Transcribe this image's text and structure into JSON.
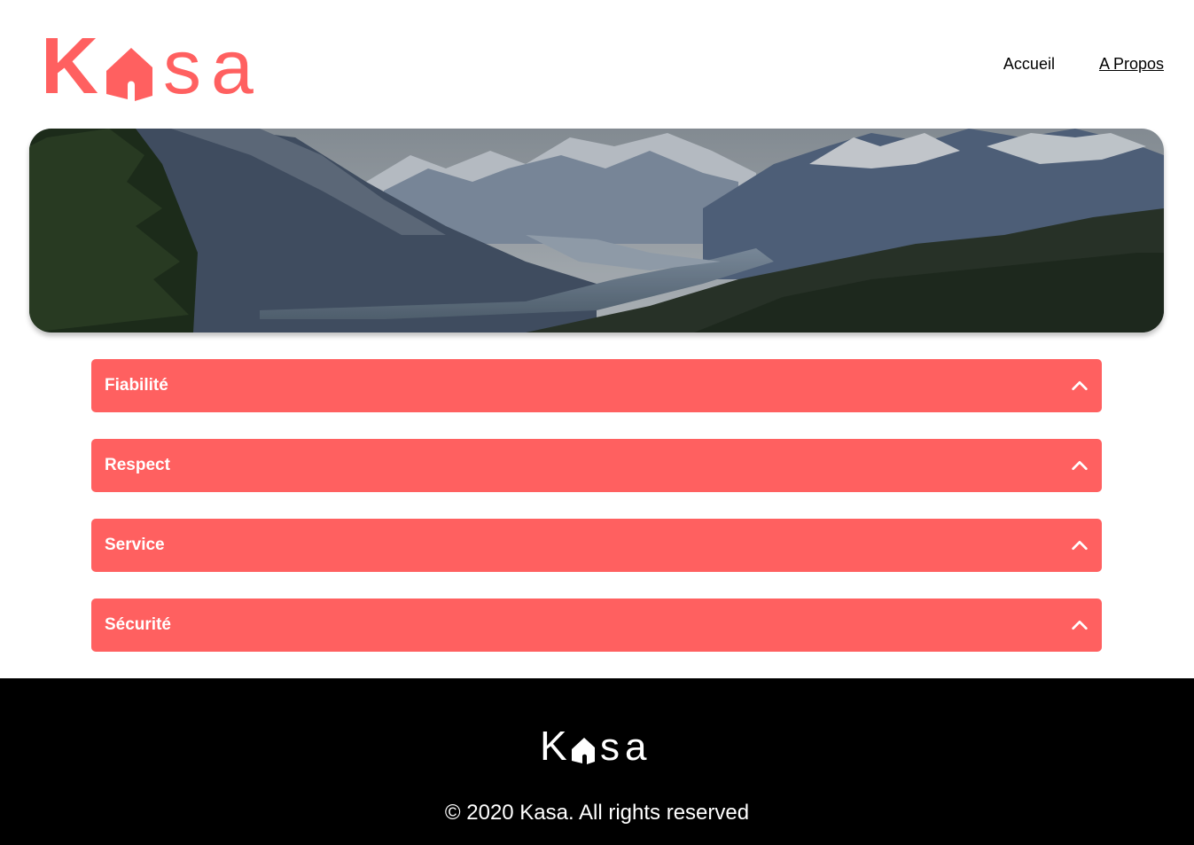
{
  "brand": {
    "name": "Kasa",
    "logo_letters": [
      "K",
      "s",
      "a"
    ],
    "accent_color": "#ff6060",
    "logo_icon": "house-icon"
  },
  "nav": {
    "items": [
      {
        "label": "Accueil",
        "active": false
      },
      {
        "label": "A Propos",
        "active": true
      }
    ]
  },
  "banner": {
    "image": "mountain-landscape-image"
  },
  "collapses": [
    {
      "title": "Fiabilité",
      "icon": "chevron-up-icon",
      "expanded": false
    },
    {
      "title": "Respect",
      "icon": "chevron-up-icon",
      "expanded": false
    },
    {
      "title": "Service",
      "icon": "chevron-up-icon",
      "expanded": false
    },
    {
      "title": "Sécurité",
      "icon": "chevron-up-icon",
      "expanded": false
    }
  ],
  "footer": {
    "copyright": "© 2020 Kasa. All rights reserved",
    "background": "#000000",
    "text_color": "#ffffff"
  }
}
